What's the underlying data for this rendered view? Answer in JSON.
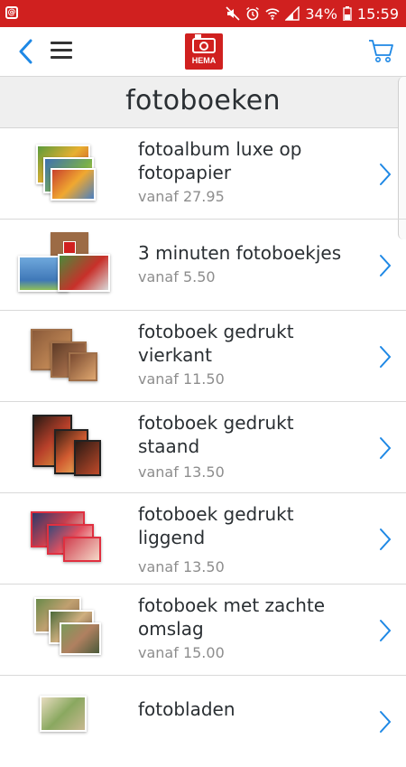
{
  "status_bar": {
    "battery": "34%",
    "time": "15:59"
  },
  "app_bar": {
    "logo_text": "HEMA"
  },
  "page": {
    "title": "fotoboeken"
  },
  "products": [
    {
      "title": "fotoalbum luxe op fotopapier",
      "price": "vanaf 27.95"
    },
    {
      "title": "3 minuten fotoboekjes",
      "price": "vanaf 5.50"
    },
    {
      "title": "fotoboek gedrukt vierkant",
      "price": "vanaf 11.50"
    },
    {
      "title": "fotoboek gedrukt staand",
      "price": "vanaf 13.50"
    },
    {
      "title": "fotoboek gedrukt liggend",
      "price": "vanaf 13.50"
    },
    {
      "title": "fotoboek met zachte omslag",
      "price": "vanaf 15.00"
    },
    {
      "title": "fotobladen",
      "price": ""
    }
  ],
  "colors": {
    "brand_red": "#d0201f",
    "accent_blue": "#1e88e5",
    "text_dark": "#2a2f33",
    "text_muted": "#8d8d8d"
  }
}
